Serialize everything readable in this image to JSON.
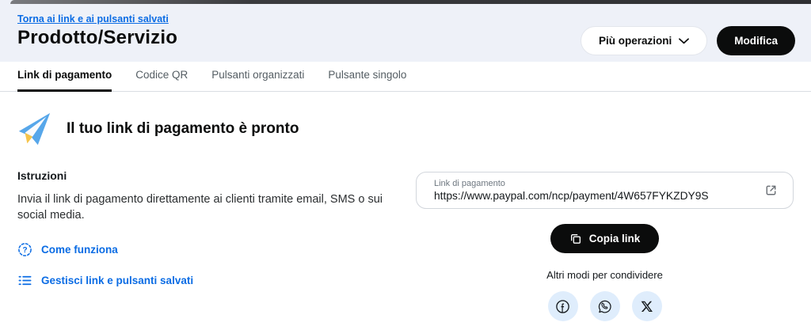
{
  "colors": {
    "accent_blue": "#0b6ce4",
    "header_bg": "#eef1f8",
    "button_black": "#0b0c0c",
    "share_circle_bg": "#dfedfc",
    "plane_blue": "#57a7ea",
    "plane_yellow": "#f6c44a"
  },
  "header": {
    "back_link": "Torna ai link e ai pulsanti salvati",
    "title": "Prodotto/Servizio",
    "more_operations_button": "Più operazioni",
    "edit_button": "Modifica"
  },
  "tabs": [
    {
      "label": "Link di pagamento",
      "active": true
    },
    {
      "label": "Codice QR",
      "active": false
    },
    {
      "label": "Pulsanti organizzati",
      "active": false
    },
    {
      "label": "Pulsante singolo",
      "active": false
    }
  ],
  "hero": {
    "heading": "Il tuo link di pagamento è pronto",
    "icon": "paper-plane-icon"
  },
  "instructions": {
    "heading": "Istruzioni",
    "body": "Invia il link di pagamento direttamente ai clienti tramite email, SMS o sui social media.",
    "links": [
      {
        "label": "Come funziona",
        "icon": "help-badge-icon"
      },
      {
        "label": "Gestisci link e pulsanti salvati",
        "icon": "list-icon"
      }
    ]
  },
  "payment_link": {
    "field_label": "Link di pagamento",
    "field_value": "https://www.paypal.com/ncp/payment/4W657FYKZDY9S",
    "preview_icon": "open-link-icon",
    "copy_button": "Copia link",
    "share_heading": "Altri modi per condividere",
    "share_options": [
      {
        "name": "facebook",
        "icon": "facebook-icon"
      },
      {
        "name": "whatsapp",
        "icon": "whatsapp-icon"
      },
      {
        "name": "x",
        "icon": "x-icon"
      }
    ]
  }
}
